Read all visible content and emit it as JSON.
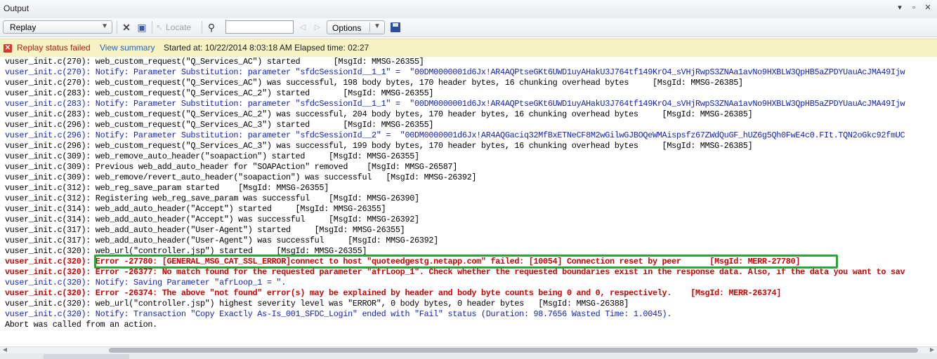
{
  "window": {
    "title": "Output",
    "controls": [
      "▾",
      "▫",
      "✕"
    ]
  },
  "toolbar": {
    "replay_select": "Replay",
    "clear_icon": "x-icon",
    "locate_label": "Locate",
    "search_placeholder": "",
    "options_label": "Options"
  },
  "status": {
    "icon": "x-error-icon",
    "failed_text": "Replay status failed",
    "link_text": "View summary",
    "info_text": "Started at: 10/22/2014 8:03:18 AM Elapsed time: 02:27"
  },
  "log": [
    {
      "color": "black",
      "text": "vuser_init.c(270): web_custom_request(\"Q_Services_AC\") started       [MsgId: MMSG-26355]"
    },
    {
      "color": "blue",
      "text": "vuser_init.c(270): Notify: Parameter Substitution: parameter \"sfdcSessionId__1_1\" =  \"00DM0000001d6Jx!AR4AQPtseGKt6UWD1uyAHakU3J764tf149KrO4_sVHjRwpS3ZNAa1avNo9HXBLW3QpHB5aZPDYUauAcJMA49Ijw"
    },
    {
      "color": "black",
      "text": "vuser_init.c(270): web_custom_request(\"Q_Services_AC\") was successful, 198 body bytes, 170 header bytes, 16 chunking overhead bytes     [MsgId: MMSG-26385]"
    },
    {
      "color": "black",
      "text": "vuser_init.c(283): web_custom_request(\"Q_Services_AC_2\") started       [MsgId: MMSG-26355]"
    },
    {
      "color": "blue",
      "text": "vuser_init.c(283): Notify: Parameter Substitution: parameter \"sfdcSessionId__1_1\" =  \"00DM0000001d6Jx!AR4AQPtseGKt6UWD1uyAHakU3J764tf149KrO4_sVHjRwpS3ZNAa1avNo9HXBLW3QpHB5aZPDYUauAcJMA49Ijw"
    },
    {
      "color": "black",
      "text": "vuser_init.c(283): web_custom_request(\"Q_Services_AC_2\") was successful, 204 body bytes, 170 header bytes, 16 chunking overhead bytes     [MsgId: MMSG-26385]"
    },
    {
      "color": "black",
      "text": "vuser_init.c(296): web_custom_request(\"Q_Services_AC_3\") started       [MsgId: MMSG-26355]"
    },
    {
      "color": "blue",
      "text": "vuser_init.c(296): Notify: Parameter Substitution: parameter \"sfdcSessionId__2\" =  \"00DM0000001d6Jx!AR4AQGaciq32MfBxETNeCF8M2wGilwGJBOQeWMAispsfz67ZWdQuGF_hUZ6g5Qh0FwE4c0.FIt.TQN2oGkc92fmUC"
    },
    {
      "color": "black",
      "text": "vuser_init.c(296): web_custom_request(\"Q_Services_AC_3\") was successful, 199 body bytes, 170 header bytes, 16 chunking overhead bytes     [MsgId: MMSG-26385]"
    },
    {
      "color": "black",
      "text": "vuser_init.c(309): web_remove_auto_header(\"soapaction\") started     [MsgId: MMSG-26355]"
    },
    {
      "color": "black",
      "text": "vuser_init.c(309): Previous web_add_auto_header for \"SOAPAction\" removed    [MsgId: MMSG-26587]"
    },
    {
      "color": "black",
      "text": "vuser_init.c(309): web_remove/revert_auto_header(\"soapaction\") was successful   [MsgId: MMSG-26392]"
    },
    {
      "color": "black",
      "text": "vuser_init.c(312): web_reg_save_param started    [MsgId: MMSG-26355]"
    },
    {
      "color": "black",
      "text": "vuser_init.c(312): Registering web_reg_save_param was successful    [MsgId: MMSG-26390]"
    },
    {
      "color": "black",
      "text": "vuser_init.c(314): web_add_auto_header(\"Accept\") started     [MsgId: MMSG-26355]"
    },
    {
      "color": "black",
      "text": "vuser_init.c(314): web_add_auto_header(\"Accept\") was successful     [MsgId: MMSG-26392]"
    },
    {
      "color": "black",
      "text": "vuser_init.c(317): web_add_auto_header(\"User-Agent\") started     [MsgId: MMSG-26355]"
    },
    {
      "color": "black",
      "text": "vuser_init.c(317): web_add_auto_header(\"User-Agent\") was successful     [MsgId: MMSG-26392]"
    },
    {
      "color": "black",
      "text": "vuser_init.c(320): web_url(\"controller.jsp\") started     [MsgId: MMSG-26355]"
    },
    {
      "color": "red",
      "text": "vuser_init.c(320): Error -27780: [GENERAL_MSG_CAT_SSL_ERROR]connect to host \"quoteedgestg.netapp.com\" failed: [10054] Connection reset by peer      [MsgId: MERR-27780]"
    },
    {
      "color": "red",
      "text": "vuser_init.c(320): Error -26377: No match found for the requested parameter \"afrLoop_1\". Check whether the requested boundaries exist in the response data. Also, if the data you want to sav"
    },
    {
      "color": "blue",
      "text": "vuser_init.c(320): Notify: Saving Parameter \"afrLoop_1 = \"."
    },
    {
      "color": "red",
      "text": "vuser_init.c(320): Error -26374: The above \"not found\" error(s) may be explained by header and body byte counts being 0 and 0, respectively.    [MsgId: MERR-26374]"
    },
    {
      "color": "black",
      "text": "vuser_init.c(320): web_url(\"controller.jsp\") highest severity level was \"ERROR\", 0 body bytes, 0 header bytes   [MsgId: MMSG-26388]"
    },
    {
      "color": "blue",
      "text": "vuser_init.c(320): Notify: Transaction \"Copy Exactly As-Is_001_SFDC_Login\" ended with \"Fail\" status (Duration: 98.7656 Wasted Time: 1.0045)."
    },
    {
      "color": "black",
      "text": "Abort was called from an action."
    }
  ]
}
